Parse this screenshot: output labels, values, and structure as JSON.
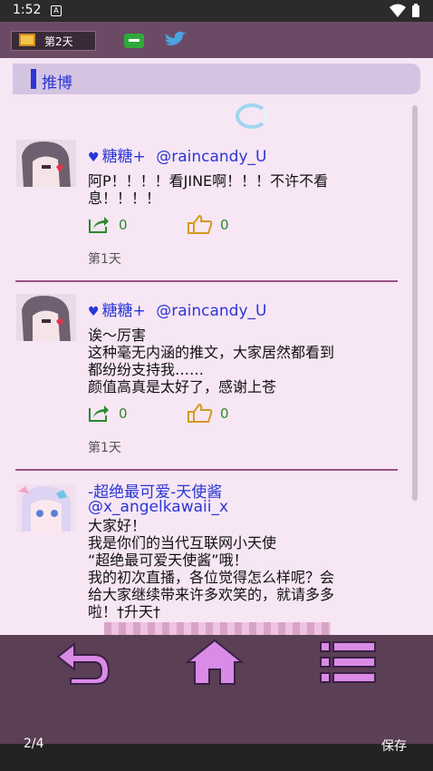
{
  "status_bar": {
    "time": "1:52",
    "notification_icon": "A"
  },
  "topbar": {
    "day_label": "第2天"
  },
  "section": {
    "title": "推博"
  },
  "posts": [
    {
      "author_name": "糖糖+",
      "handle": "@raincandy_U",
      "lines": [
        "阿P！！！！看JINE啊！！！不许不看",
        "息！！！！"
      ],
      "shares": "0",
      "likes": "0",
      "day": "第1天"
    },
    {
      "author_name": "糖糖+",
      "handle": "@raincandy_U",
      "lines": [
        "诶～厉害",
        "这种毫无内涵的推文，大家居然都看到",
        "都纷纷支持我……",
        "颜值高真是太好了，感谢上苍"
      ],
      "shares": "0",
      "likes": "0",
      "day": "第1天"
    },
    {
      "author_name": "-超绝最可爱-天使酱",
      "handle": "@x_angelkawaii_x",
      "lines": [
        "大家好！",
        "我是你们的当代互联网小天使",
        "“超绝最可爱天使酱”哦！",
        "我的初次直播，各位觉得怎么样呢？会",
        "给大家继续带来许多欢笑的，就请多多",
        "啦！†升天†"
      ]
    }
  ],
  "bottom": {
    "page": "2/4",
    "save": "保存"
  },
  "colors": {
    "accent": "#2a36d6",
    "nav_icon": "#d98be6",
    "divider": "#9b4f86"
  }
}
